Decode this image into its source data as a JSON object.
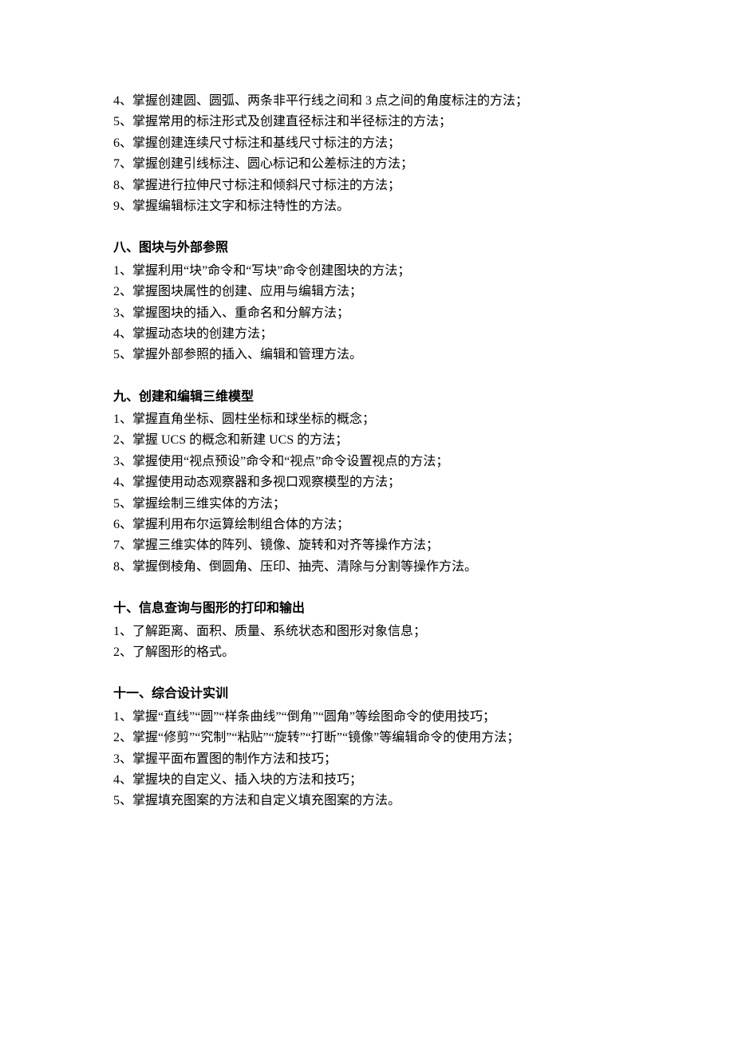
{
  "sections": [
    {
      "heading": null,
      "items": [
        "4、掌握创建圆、圆弧、两条非平行线之间和 3 点之间的角度标注的方法；",
        "5、掌握常用的标注形式及创建直径标注和半径标注的方法；",
        "6、掌握创建连续尺寸标注和基线尺寸标注的方法；",
        "7、掌握创建引线标注、圆心标记和公差标注的方法；",
        "8、掌握进行拉伸尺寸标注和倾斜尺寸标注的方法；",
        "9、掌握编辑标注文字和标注特性的方法。"
      ]
    },
    {
      "heading": "八、图块与外部参照",
      "items": [
        "1、掌握利用“块”命令和“写块”命令创建图块的方法；",
        "2、掌握图块属性的创建、应用与编辑方法；",
        "3、掌握图块的插入、重命名和分解方法；",
        "4、掌握动态块的创建方法；",
        "5、掌握外部参照的插入、编辑和管理方法。"
      ]
    },
    {
      "heading": "九、创建和编辑三维模型",
      "items": [
        "1、掌握直角坐标、圆柱坐标和球坐标的概念；",
        "2、掌握 UCS 的概念和新建 UCS 的方法；",
        "3、掌握使用“视点预设”命令和“视点”命令设置视点的方法；",
        "4、掌握使用动态观察器和多视口观察模型的方法；",
        "5、掌握绘制三维实体的方法；",
        "6、掌握利用布尔运算绘制组合体的方法；",
        "7、掌握三维实体的阵列、镜像、旋转和对齐等操作方法；",
        "8、掌握倒棱角、倒圆角、压印、抽壳、清除与分割等操作方法。"
      ]
    },
    {
      "heading": "十、信息查询与图形的打印和输出",
      "items": [
        "1、了解距离、面积、质量、系统状态和图形对象信息；",
        "2、了解图形的格式。"
      ]
    },
    {
      "heading": "十一、综合设计实训",
      "items": [
        "1、掌握“直线”“圆”“样条曲线”“倒角”“圆角”等绘图命令的使用技巧；",
        "2、掌握“修剪”“究制”“粘贴”“旋转”“打断”“镜像”等编辑命令的使用方法；",
        "3、掌握平面布置图的制作方法和技巧；",
        "4、掌握块的自定义、插入块的方法和技巧；",
        "5、掌握填充图案的方法和自定义填充图案的方法。"
      ]
    }
  ]
}
